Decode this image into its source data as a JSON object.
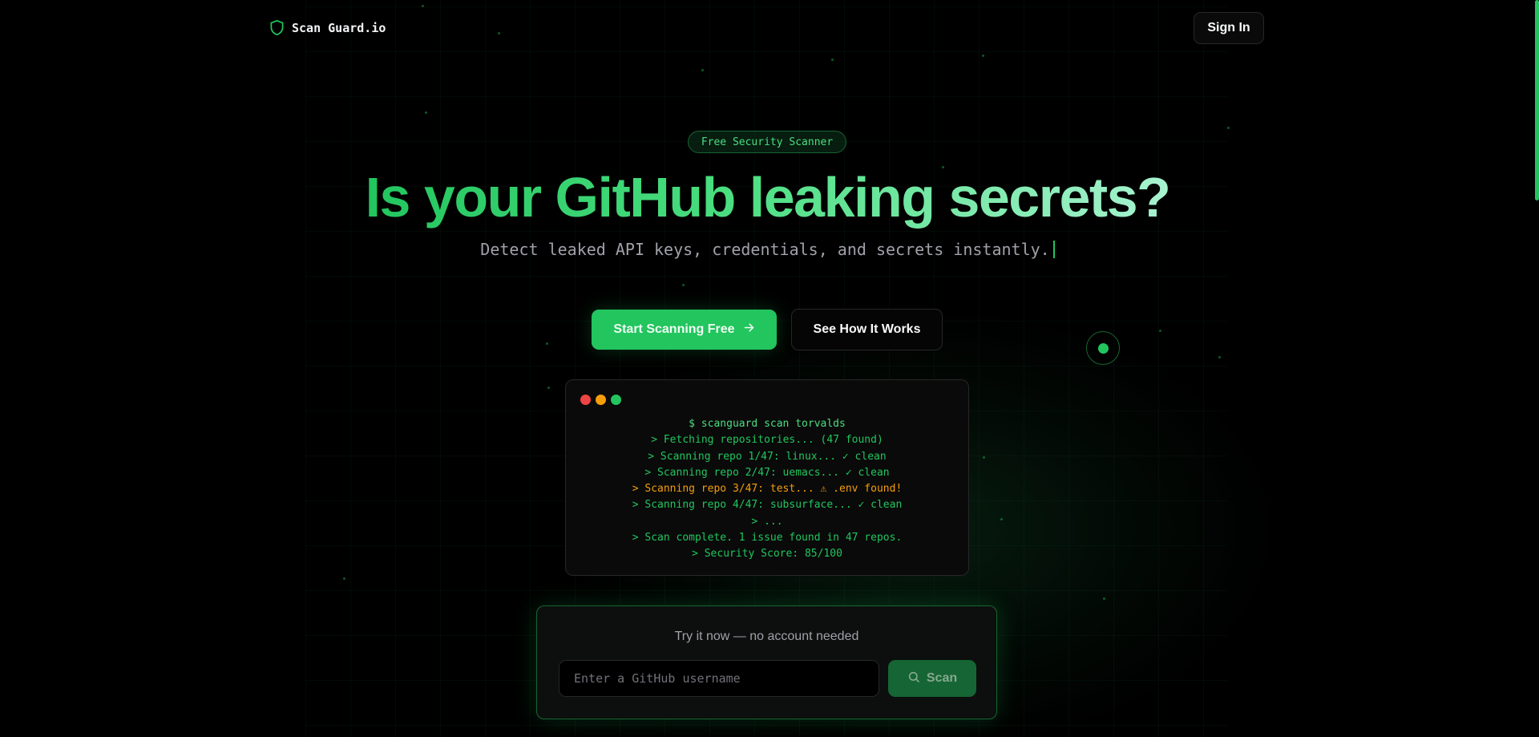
{
  "header": {
    "logo_text": "Scan Guard.io",
    "sign_in_label": "Sign In"
  },
  "hero": {
    "badge": "Free Security Scanner",
    "headline": "Is your GitHub leaking secrets?",
    "subline": "Detect leaked API keys, credentials, and secrets instantly."
  },
  "cta": {
    "primary_label": "Start Scanning Free",
    "secondary_label": "See How It Works"
  },
  "terminal": {
    "lines": [
      "$ scanguard scan torvalds",
      "> Fetching repositories... (47 found)",
      "> Scanning repo 1/47: linux... ✓ clean",
      "> Scanning repo 2/47: uemacs... ✓ clean",
      "> Scanning repo 3/47: test... ⚠ .env found!",
      "> Scanning repo 4/47: subsurface... ✓ clean",
      "> ...",
      "> Scan complete. 1 issue found in 47 repos.",
      "> Security Score: 85/100"
    ]
  },
  "try_it": {
    "title": "Try it now — no account needed",
    "input_placeholder": "Enter a GitHub username",
    "scan_label": "Scan"
  },
  "colors": {
    "accent": "#22c55e",
    "accent_dark": "#166534",
    "warning": "#f59e0b",
    "background": "#000000",
    "window_red": "#ef4444",
    "window_yellow": "#f59e0b",
    "window_green": "#22c55e"
  },
  "icons": {
    "logo": "shield-icon",
    "primary_button": "arrow-right-icon",
    "scan_button": "search-icon"
  }
}
